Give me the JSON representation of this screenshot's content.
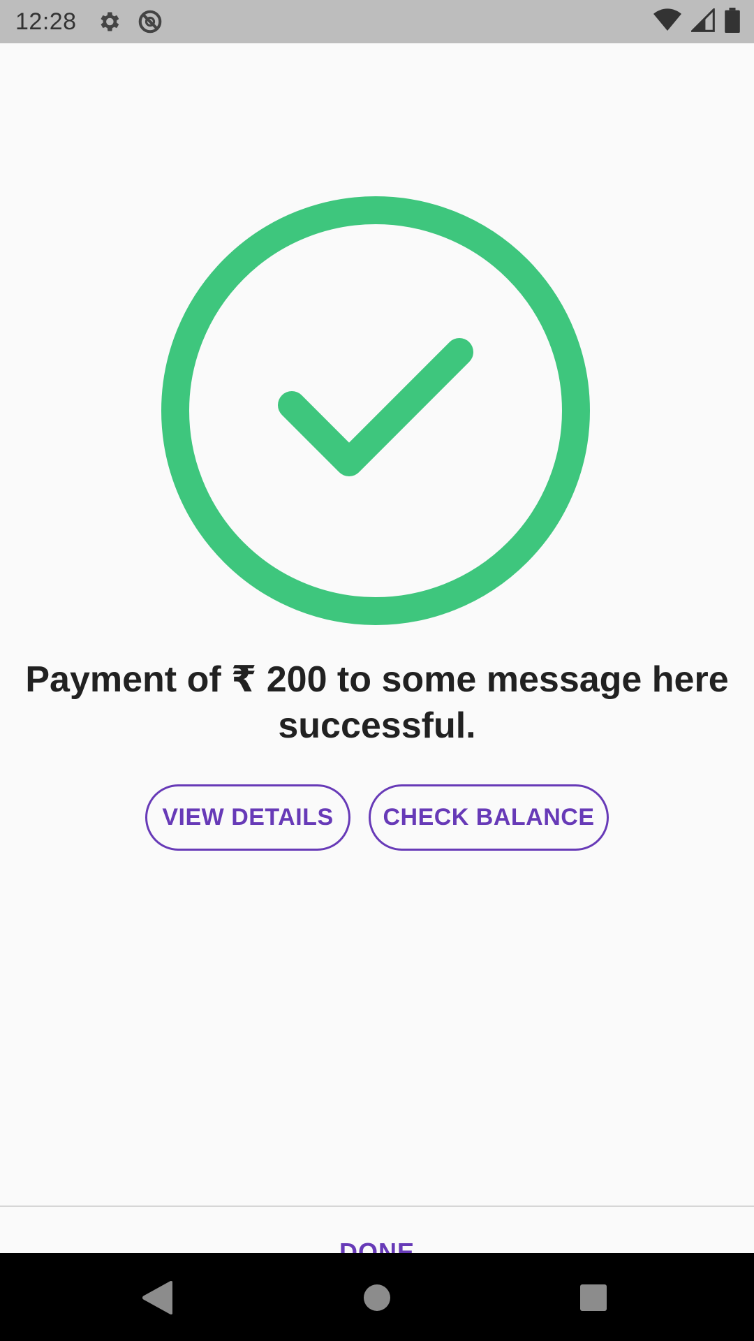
{
  "status_bar": {
    "time": "12:28",
    "icons_left": [
      "gear-icon",
      "do-not-disturb-icon"
    ],
    "icons_right": [
      "wifi-icon",
      "cell-signal-icon",
      "battery-icon"
    ]
  },
  "success": {
    "icon": "check-circle-icon",
    "color": "#3ec67d",
    "message": "Payment of ₹ 200 to some message here successful."
  },
  "actions": {
    "view_details_label": "VIEW DETAILS",
    "check_balance_label": "CHECK BALANCE",
    "accent_color": "#673ab7"
  },
  "footer": {
    "done_label": "DONE"
  },
  "nav_bar": {
    "icons": [
      "back-icon",
      "home-icon",
      "recent-apps-icon"
    ]
  }
}
